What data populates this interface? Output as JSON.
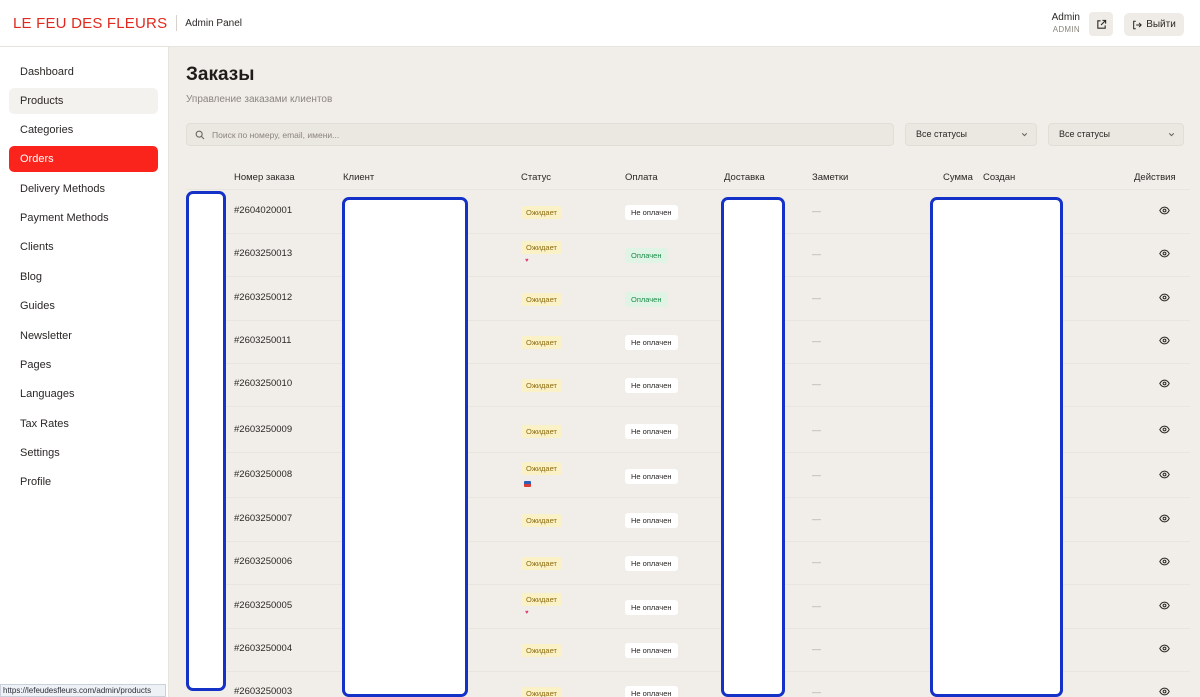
{
  "topbar": {
    "brand": "LE FEU DES FLEURS",
    "panel_label": "Admin Panel",
    "user_name": "Admin",
    "user_role": "ADMIN",
    "logout_label": "Выйти"
  },
  "sidebar": {
    "items": [
      {
        "label": "Dashboard"
      },
      {
        "label": "Products"
      },
      {
        "label": "Categories"
      },
      {
        "label": "Orders"
      },
      {
        "label": "Delivery Methods"
      },
      {
        "label": "Payment Methods"
      },
      {
        "label": "Clients"
      },
      {
        "label": "Blog"
      },
      {
        "label": "Guides"
      },
      {
        "label": "Newsletter"
      },
      {
        "label": "Pages"
      },
      {
        "label": "Languages"
      },
      {
        "label": "Tax Rates"
      },
      {
        "label": "Settings"
      },
      {
        "label": "Profile"
      }
    ],
    "active": "Orders",
    "hover": "Products"
  },
  "page": {
    "title": "Заказы",
    "subtitle": "Управление заказами клиентов"
  },
  "filters": {
    "search_placeholder": "Поиск по номеру, email, имени...",
    "status_select_1": "Все статусы",
    "status_select_2": "Все статусы"
  },
  "table": {
    "headers": {
      "number": "Номер заказа",
      "client": "Клиент",
      "status": "Статус",
      "payment": "Оплата",
      "delivery": "Доставка",
      "notes": "Заметки",
      "sum": "Сумма",
      "created": "Создан",
      "actions": "Действия"
    },
    "rows": [
      {
        "number": "#2604020001",
        "status": "Ожидает",
        "payment": "Не оплачен",
        "paid": false,
        "marker": "",
        "notes": "—"
      },
      {
        "number": "#2603250013",
        "status": "Ожидает",
        "payment": "Оплачен",
        "paid": true,
        "marker": "dot",
        "notes": "—"
      },
      {
        "number": "#2603250012",
        "status": "Ожидает",
        "payment": "Оплачен",
        "paid": true,
        "marker": "",
        "notes": "—"
      },
      {
        "number": "#2603250011",
        "status": "Ожидает",
        "payment": "Не оплачен",
        "paid": false,
        "marker": "",
        "notes": "—"
      },
      {
        "number": "#2603250010",
        "status": "Ожидает",
        "payment": "Не оплачен",
        "paid": false,
        "marker": "",
        "notes": "—"
      },
      {
        "number": "#2603250009",
        "status": "Ожидает",
        "payment": "Не оплачен",
        "paid": false,
        "marker": "",
        "notes": "—"
      },
      {
        "number": "#2603250008",
        "status": "Ожидает",
        "payment": "Не оплачен",
        "paid": false,
        "marker": "flag",
        "notes": "—"
      },
      {
        "number": "#2603250007",
        "status": "Ожидает",
        "payment": "Не оплачен",
        "paid": false,
        "marker": "",
        "notes": "—"
      },
      {
        "number": "#2603250006",
        "status": "Ожидает",
        "payment": "Не оплачен",
        "paid": false,
        "marker": "",
        "notes": "—"
      },
      {
        "number": "#2603250005",
        "status": "Ожидает",
        "payment": "Не оплачен",
        "paid": false,
        "marker": "dot",
        "notes": "—"
      },
      {
        "number": "#2603250004",
        "status": "Ожидает",
        "payment": "Не оплачен",
        "paid": false,
        "marker": "",
        "notes": "—"
      },
      {
        "number": "#2603250003",
        "status": "Ожидает",
        "payment": "Не оплачен",
        "paid": false,
        "marker": "",
        "notes": "—"
      }
    ]
  },
  "browser_status_url": "https://lefeudesfleurs.com/admin/products",
  "icons": {
    "external": "external-link-icon",
    "logout": "logout-icon",
    "search": "search-icon",
    "chevron": "chevron-down-icon",
    "view": "eye-icon"
  },
  "colors": {
    "brand": "#e02a1e",
    "active_nav": "#fa241c",
    "status_wait_bg": "#fbf1c6",
    "status_wait_text": "#8c6d12",
    "paid_bg": "#e0f4e6",
    "paid_text": "#1c8a49",
    "redaction_border": "#1432c8"
  }
}
